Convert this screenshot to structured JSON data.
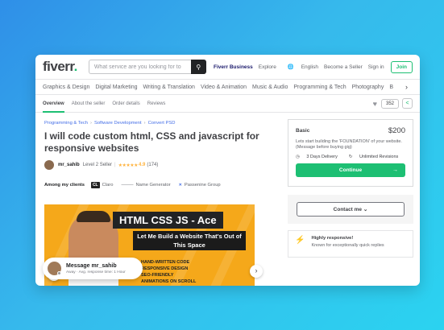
{
  "header": {
    "logo": "fiverr",
    "logo_dot": ".",
    "search_placeholder": "What service are you looking for to",
    "search_icon": "search-icon",
    "nav": {
      "business": "Fiverr Business",
      "explore": "Explore",
      "language": "English",
      "become_seller": "Become a Seller",
      "sign_in": "Sign in",
      "join": "Join"
    }
  },
  "categories": [
    "Graphics & Design",
    "Digital Marketing",
    "Writing & Translation",
    "Video & Animation",
    "Music & Audio",
    "Programming & Tech",
    "Photography",
    "B"
  ],
  "tabs": [
    "Overview",
    "About the seller",
    "Order details",
    "Reviews"
  ],
  "likes_count": "352",
  "breadcrumb": [
    "Programming & Tech",
    "Software Development",
    "Convert PSD"
  ],
  "gig_title": "I will code custom html, CSS and javascript for responsive websites",
  "seller": {
    "name": "mr_sahib",
    "level": "Level 2 Seller",
    "stars": "★★★★★",
    "rating": "4.9",
    "reviews": "(174)"
  },
  "clients": {
    "label": "Among my clients",
    "items": [
      {
        "mark": "CL",
        "name": "Claro"
      },
      {
        "mark": "———",
        "name": "Name Generator"
      },
      {
        "mark": "✕",
        "name": "Passenine Group"
      }
    ]
  },
  "gallery": {
    "title": "HTML CSS JS - Ace",
    "subtitle": "Let Me Build a Website That's Out of This Space",
    "features": [
      "HAND-WRITTEN CODE",
      "RESPONSIVE DESIGN",
      "SEO-FRIENDLY",
      "ANIMATIONS ON SCROLL"
    ],
    "bg_color": "#f5a81a"
  },
  "message_bubble": {
    "title": "Message mr_sahib",
    "status": "Away · Avg. response time: 1 Hour"
  },
  "package": {
    "name": "Basic",
    "price": "$200",
    "description": "Lets start building the 'FOUNDATION' of your website. (Message before buying gig)",
    "delivery": "3 Days Delivery",
    "revisions": "Unlimited Revisions",
    "continue": "Continue"
  },
  "contact": {
    "label": "Contact me"
  },
  "responsive": {
    "title": "Highly responsive!",
    "subtitle": "Known for exceptionally quick replies"
  },
  "colors": {
    "brand_green": "#1dbf73",
    "text_dark": "#404145",
    "link_blue": "#446ee7",
    "star": "#ffb33e"
  }
}
